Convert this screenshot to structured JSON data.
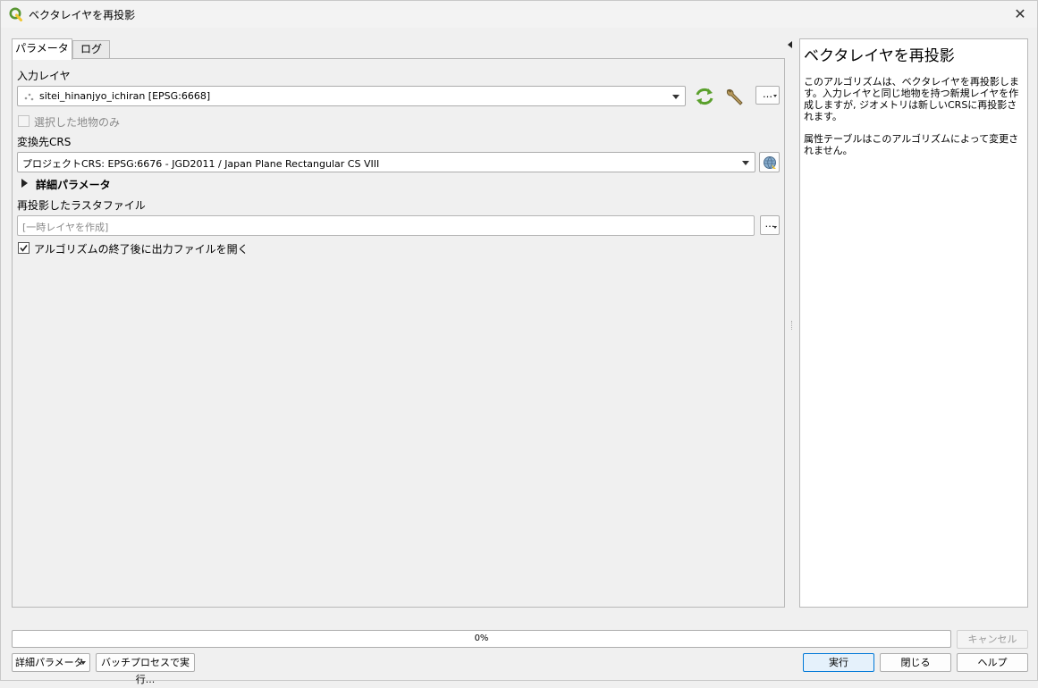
{
  "window": {
    "title": "ベクタレイヤを再投影",
    "close_icon": "close-icon"
  },
  "tabs": [
    {
      "label": "パラメータ",
      "active": true
    },
    {
      "label": "ログ",
      "active": false
    }
  ],
  "params": {
    "input_layer_label": "入力レイヤ",
    "input_layer_value": "sitei_hinanjyo_ichiran [EPSG:6668]",
    "selected_only_label": "選択した地物のみ",
    "selected_only_checked": false,
    "target_crs_label": "変換先CRS",
    "target_crs_value": "プロジェクトCRS: EPSG:6676 - JGD2011 / Japan Plane Rectangular CS VIII",
    "advanced_label": "詳細パラメータ",
    "output_label": "再投影したラスタファイル",
    "output_placeholder": "[一時レイヤを作成]",
    "open_output_label": "アルゴリズムの終了後に出力ファイルを開く",
    "open_output_checked": true,
    "more_button_label": "…",
    "browse_button_label": "…"
  },
  "help": {
    "title": "ベクタレイヤを再投影",
    "para1": "このアルゴリズムは、ベクタレイヤを再投影します。入力レイヤと同じ地物を持つ新規レイヤを作成しますが, ジオメトリは新しいCRSに再投影されます。",
    "para2": "属性テーブルはこのアルゴリズムによって変更されません。"
  },
  "footer": {
    "progress_text": "0%",
    "progress_value": 0,
    "cancel_label": "キャンセル",
    "advanced_button_label": "詳細パラメータ",
    "batch_button_label": "バッチプロセスで実行...",
    "run_label": "実行",
    "close_label": "閉じる",
    "help_label": "ヘルプ"
  },
  "colors": {
    "accent": "#0078d7",
    "qgis_green": "#589632",
    "qgis_yellow": "#f0c630"
  }
}
